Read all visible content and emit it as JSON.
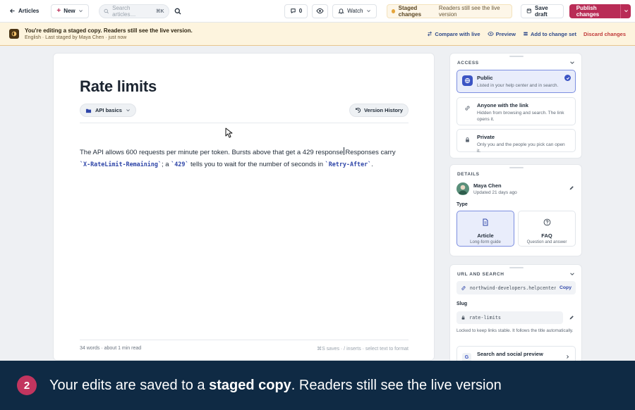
{
  "topbar": {
    "back_label": "Articles",
    "new_label": "New",
    "search_placeholder": "Search articles…",
    "search_shortcut": "⌘K",
    "comments_count": "0",
    "watch_label": "Watch",
    "staged_label": "Staged changes",
    "staged_sub": "Readers still see the live version",
    "save_draft_label": "Save draft",
    "publish_label": "Publish changes"
  },
  "banner": {
    "title": "You're editing a staged copy. Readers still see the live version.",
    "meta": "English · Last staged by Maya Chen · just now",
    "compare_label": "Compare with live",
    "preview_label": "Preview",
    "add_label": "Add to change set",
    "discard_label": "Discard changes"
  },
  "editor": {
    "title": "Rate limits",
    "collection_chip": "API basics",
    "version_history_label": "Version History",
    "body": {
      "p1": "The API allows 600 requests per minute per token. Bursts above that get a 429 response",
      "p2": "Responses carry ",
      "code1": "`X-RateLimit-Remaining`",
      "p3": "; a ",
      "code2": "`429`",
      "p4": " tells you to wait for the number of seconds in ",
      "code3": "`Retry-After`",
      "p5": "."
    },
    "word_count": "34 words · about 1 min read",
    "hint": "⌘S saves · / inserts · select text to format"
  },
  "access": {
    "heading": "ACCESS",
    "options": [
      {
        "title": "Public",
        "desc": "Listed in your help center and in search.",
        "selected": true
      },
      {
        "title": "Anyone with the link",
        "desc": "Hidden from browsing and search. The link opens it.",
        "selected": false
      },
      {
        "title": "Private",
        "desc": "Only you and the people you pick can open it.",
        "selected": false
      }
    ]
  },
  "details": {
    "heading": "DETAILS",
    "author_name": "Maya Chen",
    "updated": "Updated 21 days ago",
    "type_label": "Type",
    "types": [
      {
        "title": "Article",
        "desc": "Long-form guide",
        "selected": true
      },
      {
        "title": "FAQ",
        "desc": "Question and answer",
        "selected": false
      }
    ]
  },
  "url_search": {
    "heading": "URL AND SEARCH",
    "url": "northwind-developers.helpcenter…",
    "copy_label": "Copy",
    "slug_label": "Slug",
    "slug": "rate-limits",
    "slug_note": "Locked to keep links stable. It follows the title automatically.",
    "seo_title": "Search and social preview"
  },
  "caption": {
    "step": "2",
    "text_a": "Your edits are saved to a ",
    "text_b": "staged copy",
    "text_c": ". Readers still see the live version"
  },
  "colors": {
    "publish": "#b92c56",
    "banner_bg": "#fdf4de",
    "caption_bg": "#0f2a44",
    "accent": "#3b54c4"
  }
}
